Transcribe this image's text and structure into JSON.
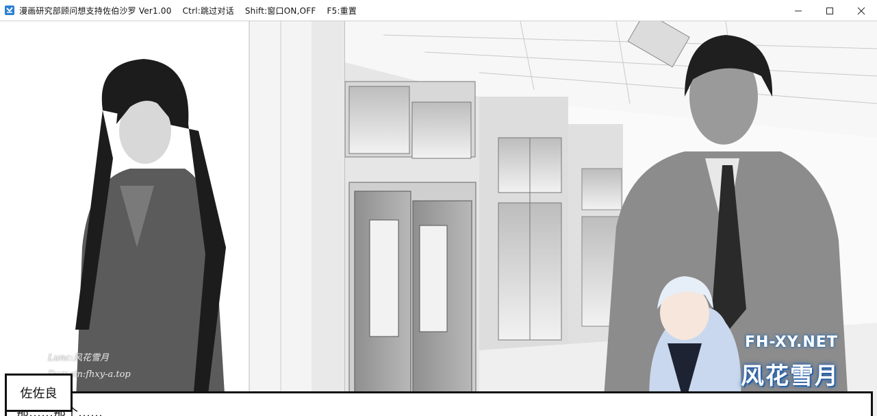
{
  "window": {
    "title": "漫画研究部顾问想支持佐伯沙罗 Ver1.00    Ctrl:跳过对话    Shift:窗口ON,OFF    F5:重置",
    "icon": "app-icon",
    "controls": [
      "minimize-icon",
      "maximize-icon",
      "close-icon"
    ]
  },
  "dialogue": {
    "speaker": "佐佐良",
    "message": "那……那个……"
  },
  "watermark": {
    "left_line1": "Lunc:风花雪月",
    "left_line2": "Domain:fhxy-a.top",
    "site": "FH-XY.NET",
    "brand": "风花雪月"
  },
  "colors": {
    "text": "#111111",
    "brand_blue": "#2f6fb3"
  }
}
